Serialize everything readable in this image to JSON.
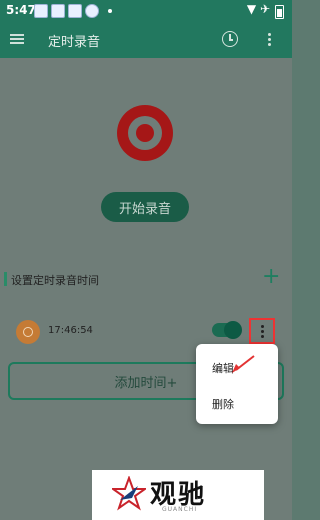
{
  "status_bar": {
    "time": "5:47"
  },
  "app_bar": {
    "title": "定时录音"
  },
  "main": {
    "start_button": "开始录音",
    "section_title": "设置定时录音时间",
    "add_plus": "+",
    "schedule_item": {
      "time": "17:46:54",
      "enabled": true
    },
    "add_time_button": "添加时间+"
  },
  "popup_menu": {
    "items": [
      "编辑",
      "删除"
    ]
  },
  "watermark": {
    "text": "观驰",
    "subtext": "GUANCHI"
  },
  "colors": {
    "primary": "#22785f",
    "record_red": "#b51c1c",
    "highlight": "#e33333"
  }
}
